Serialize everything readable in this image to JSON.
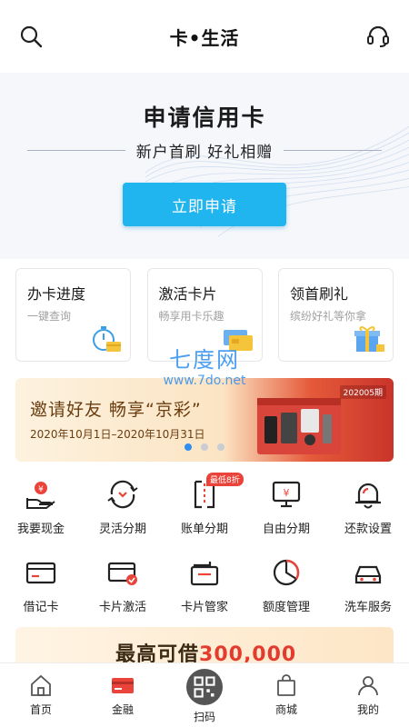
{
  "header": {
    "title": "卡•生活",
    "left_icon": "search-icon",
    "right_icon": "headset-icon"
  },
  "hero": {
    "title": "申请信用卡",
    "subtitle": "新户首刷  好礼相赠",
    "button_label": "立即申请"
  },
  "quick_cards": [
    {
      "title": "办卡进度",
      "subtitle": "一键查询",
      "icon": "stopwatch-card-icon"
    },
    {
      "title": "激活卡片",
      "subtitle": "畅享用卡乐趣",
      "icon": "card-activate-icon"
    },
    {
      "title": "领首刷礼",
      "subtitle": "缤纷好礼等你拿",
      "icon": "gift-box-icon"
    }
  ],
  "watermark": {
    "line1": "七度网",
    "line2": "www.7do.net"
  },
  "banner": {
    "title": "邀请好友 畅享“京彩”",
    "date_range": "2020年10月1日–2020年10月31日",
    "tag": "202005期",
    "pages": 3,
    "active_page": 1
  },
  "grid": {
    "row1": [
      {
        "label": "我要现金",
        "icon": "cash-hand-icon"
      },
      {
        "label": "灵活分期",
        "icon": "flexible-installment-icon"
      },
      {
        "label": "账单分期",
        "icon": "bill-installment-icon",
        "badge": "最低8折"
      },
      {
        "label": "自由分期",
        "icon": "free-installment-icon"
      },
      {
        "label": "还款设置",
        "icon": "bell-icon"
      }
    ],
    "row2": [
      {
        "label": "借记卡",
        "icon": "debit-card-icon"
      },
      {
        "label": "卡片激活",
        "icon": "card-activation-icon"
      },
      {
        "label": "卡片管家",
        "icon": "card-manager-icon"
      },
      {
        "label": "额度管理",
        "icon": "pie-chart-icon"
      },
      {
        "label": "洗车服务",
        "icon": "car-wash-icon"
      }
    ]
  },
  "promo": {
    "text_prefix": "最高可借",
    "amount": "300,000"
  },
  "tabbar": [
    {
      "label": "首页",
      "icon": "home-icon"
    },
    {
      "label": "金融",
      "icon": "finance-card-icon"
    },
    {
      "label": "扫码",
      "icon": "scan-icon"
    },
    {
      "label": "商城",
      "icon": "shopping-bag-icon"
    },
    {
      "label": "我的",
      "icon": "user-icon"
    }
  ],
  "colors": {
    "accent": "#21b5f0",
    "badge": "#e9433a",
    "dot_active": "#2f8ff0",
    "finance_red": "#e9433a"
  }
}
